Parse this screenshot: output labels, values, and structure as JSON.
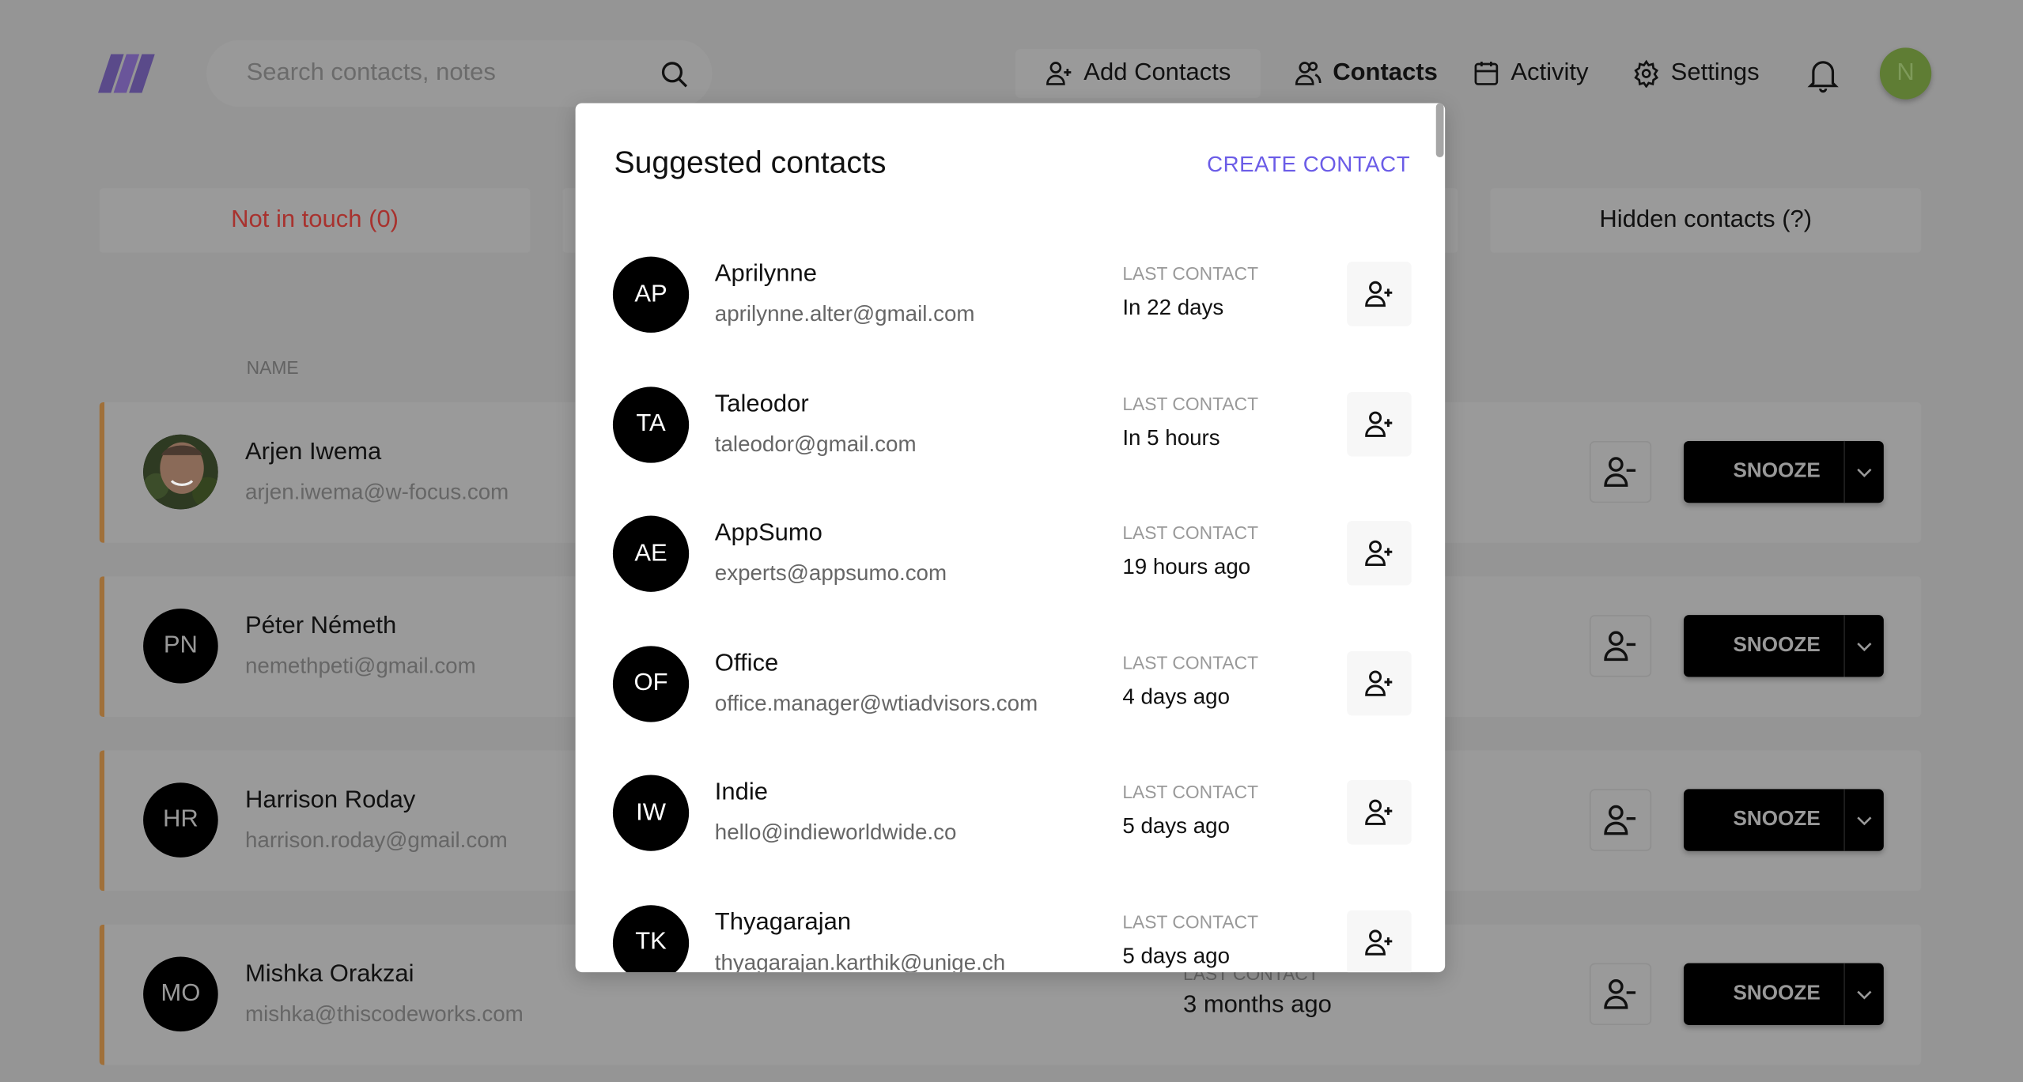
{
  "header": {
    "search_placeholder": "Search contacts, notes",
    "nav": {
      "add_contacts": "Add Contacts",
      "contacts": "Contacts",
      "activity": "Activity",
      "settings": "Settings"
    },
    "user_initial": "N",
    "avatar_color": "#6b8e3a"
  },
  "tabs": {
    "not_in_touch": "Not in touch (0)",
    "hidden": "Hidden contacts (?)"
  },
  "table": {
    "name_header": "NAME",
    "last_contact_label": "LAST CONTACT",
    "snooze_label": "SNOOZE",
    "rows": [
      {
        "initials": "",
        "name": "Arjen Iwema",
        "email": "arjen.iwema@w-focus.com",
        "photo": true
      },
      {
        "initials": "PN",
        "name": "Péter Németh",
        "email": "nemethpeti@gmail.com"
      },
      {
        "initials": "HR",
        "name": "Harrison Roday",
        "email": "harrison.roday@gmail.com"
      },
      {
        "initials": "MO",
        "name": "Mishka Orakzai",
        "email": "mishka@thiscodeworks.com",
        "last_contact": "3 months ago"
      }
    ]
  },
  "modal": {
    "title": "Suggested contacts",
    "create_label": "CREATE CONTACT",
    "accent": "#6b5ce7",
    "last_contact_label": "LAST CONTACT",
    "items": [
      {
        "initials": "AP",
        "name": "Aprilynne",
        "email": "aprilynne.alter@gmail.com",
        "last": "In 22 days"
      },
      {
        "initials": "TA",
        "name": "Taleodor",
        "email": "taleodor@gmail.com",
        "last": "In 5 hours"
      },
      {
        "initials": "AE",
        "name": "AppSumo",
        "email": "experts@appsumo.com",
        "last": "19 hours ago"
      },
      {
        "initials": "OF",
        "name": "Office",
        "email": "office.manager@wtiadvisors.com",
        "last": "4 days ago"
      },
      {
        "initials": "IW",
        "name": "Indie",
        "email": "hello@indieworldwide.co",
        "last": "5 days ago"
      },
      {
        "initials": "TK",
        "name": "Thyagarajan",
        "email": "thyagarajan.karthik@unige.ch",
        "last": "5 days ago"
      }
    ]
  }
}
